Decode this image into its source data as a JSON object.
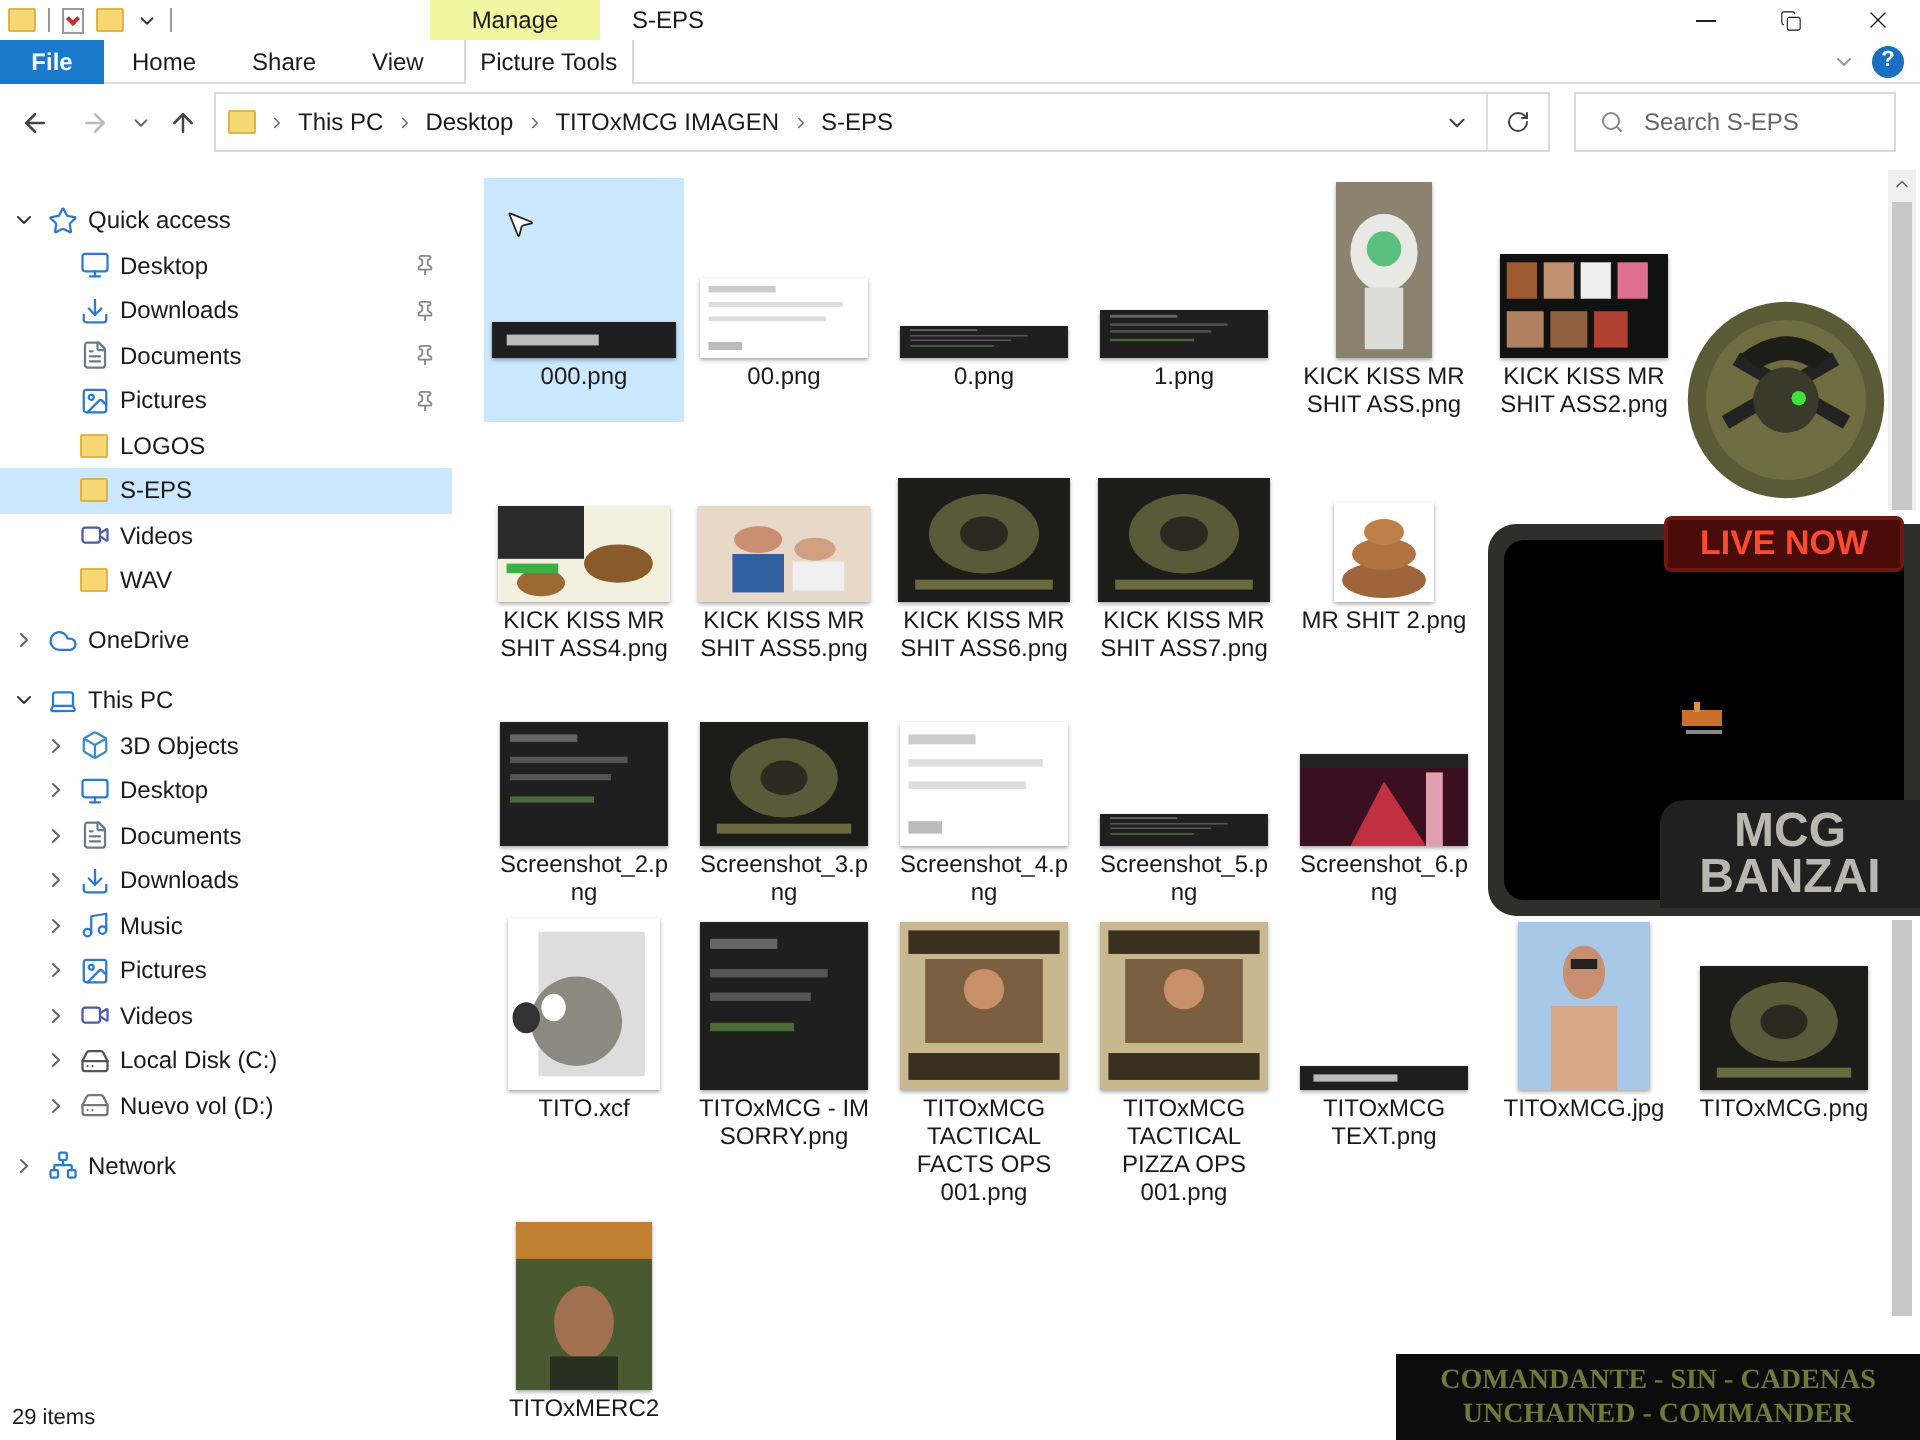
{
  "ribbon": {
    "contextual_label": "Manage",
    "title": "S-EPS",
    "help": "?",
    "tabs": [
      {
        "label": "File",
        "kind": "file",
        "selected": false
      },
      {
        "label": "Home",
        "kind": "plain",
        "selected": false
      },
      {
        "label": "Share",
        "kind": "plain",
        "selected": false
      },
      {
        "label": "View",
        "kind": "plain",
        "selected": false
      },
      {
        "label": "Picture Tools",
        "kind": "contextual",
        "selected": false
      }
    ]
  },
  "address_bar": {
    "path": [
      "This PC",
      "Desktop",
      "TITOxMCG IMAGEN",
      "S-EPS"
    ]
  },
  "search": {
    "placeholder": "Search S-EPS"
  },
  "sidebar": {
    "items": [
      {
        "label": "Quick access",
        "kind": "star",
        "expanded": true,
        "selected": false,
        "children": [
          {
            "label": "Desktop",
            "kind": "desktop",
            "pinned": true,
            "selected": false
          },
          {
            "label": "Downloads",
            "kind": "download",
            "pinned": true,
            "selected": false
          },
          {
            "label": "Documents",
            "kind": "documents",
            "pinned": true,
            "selected": false
          },
          {
            "label": "Pictures",
            "kind": "pictures",
            "pinned": true,
            "selected": false
          },
          {
            "label": "LOGOS",
            "kind": "folder",
            "pinned": false,
            "selected": false
          },
          {
            "label": "S-EPS",
            "kind": "folder",
            "pinned": false,
            "selected": true
          },
          {
            "label": "Videos",
            "kind": "videos",
            "pinned": false,
            "selected": false
          },
          {
            "label": "WAV",
            "kind": "folder",
            "pinned": false,
            "selected": false
          }
        ]
      },
      {
        "label": "OneDrive",
        "kind": "cloud",
        "expanded": false,
        "selected": false
      },
      {
        "label": "This PC",
        "kind": "pc",
        "expanded": true,
        "selected": false,
        "children": [
          {
            "label": "3D Objects",
            "kind": "objects",
            "expanded": false,
            "selected": false
          },
          {
            "label": "Desktop",
            "kind": "desktop",
            "expanded": false,
            "selected": false
          },
          {
            "label": "Documents",
            "kind": "documents",
            "expanded": false,
            "selected": false
          },
          {
            "label": "Downloads",
            "kind": "download",
            "expanded": false,
            "selected": false
          },
          {
            "label": "Music",
            "kind": "music",
            "expanded": false,
            "selected": false
          },
          {
            "label": "Pictures",
            "kind": "pictures",
            "expanded": false,
            "selected": false
          },
          {
            "label": "Videos",
            "kind": "videos",
            "expanded": false,
            "selected": false
          },
          {
            "label": "Local Disk (C:)",
            "kind": "disk",
            "expanded": false,
            "selected": false
          },
          {
            "label": "Nuevo vol (D:)",
            "kind": "drive",
            "expanded": false,
            "selected": false
          }
        ]
      },
      {
        "label": "Network",
        "kind": "network",
        "expanded": false,
        "selected": false
      }
    ]
  },
  "files": [
    {
      "label": "000.png",
      "selected": true
    },
    {
      "label": "00.png",
      "selected": false
    },
    {
      "label": "0.png",
      "selected": false
    },
    {
      "label": "1.png",
      "selected": false
    },
    {
      "label": "KICK KISS MR SHIT ASS.png",
      "selected": false
    },
    {
      "label": "KICK KISS MR SHIT ASS2.png",
      "selected": false
    },
    {
      "kind": "picture"
    },
    {
      "label": "KICK KISS MR SHIT ASS4.png",
      "selected": false
    },
    {
      "label": "KICK KISS MR SHIT ASS5.png",
      "selected": false
    },
    {
      "label": "KICK KISS MR SHIT ASS6.png",
      "selected": false
    },
    {
      "label": "KICK KISS MR SHIT ASS7.png",
      "selected": false
    },
    {
      "label": "MR SHIT 2.png",
      "selected": false
    },
    {
      "kind": "picture"
    },
    {
      "kind": "picture"
    },
    {
      "label": "Screenshot_2.png",
      "selected": false
    },
    {
      "label": "Screenshot_3.png",
      "selected": false
    },
    {
      "label": "Screenshot_4.png",
      "selected": false
    },
    {
      "label": "Screenshot_5.png",
      "selected": false
    },
    {
      "label": "Screenshot_6.png",
      "selected": false
    },
    {
      "kind": "picture"
    },
    {
      "kind": "picture"
    },
    {
      "label": "TITO.xcf",
      "selected": false
    },
    {
      "label": "TITOxMCG - IM SORRY.png",
      "selected": false
    },
    {
      "label": "TITOxMCG TACTICAL FACTS OPS 001.png",
      "selected": false
    },
    {
      "label": "TITOxMCG TACTICAL PIZZA OPS 001.png",
      "selected": false
    },
    {
      "label": "TITOxMCG TEXT.png",
      "selected": false
    },
    {
      "label": "TITOxMCG.jpg",
      "selected": false
    },
    {
      "label": "TITOxMCG.png",
      "selected": false
    },
    {
      "label": "TITOxMERC2",
      "selected": false
    }
  ],
  "status_bar": {
    "count": "29 items"
  },
  "overlay": {
    "live_badge": "LIVE NOW",
    "brand": [
      "MCG",
      "BANZAI"
    ],
    "banner": [
      "COMANDANTE - SIN - CADENAS",
      "UNCHAINED - COMMANDER"
    ]
  }
}
